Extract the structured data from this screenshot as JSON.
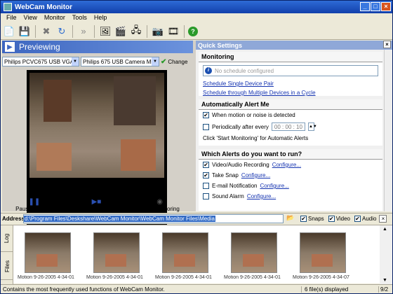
{
  "app": {
    "title": "WebCam Monitor"
  },
  "menu": [
    "File",
    "View",
    "Monitor",
    "Tools",
    "Help"
  ],
  "toolbar": {
    "tools": [
      {
        "name": "new-icon",
        "glyph": "📄"
      },
      {
        "name": "save-icon",
        "glyph": "💾"
      },
      {
        "name": "delete-icon",
        "glyph": "✖"
      },
      {
        "name": "refresh-icon",
        "glyph": "↻"
      },
      {
        "name": "forward-icon",
        "glyph": "»"
      },
      {
        "name": "snapshot-icon",
        "glyph": "🖼"
      },
      {
        "name": "record-icon",
        "glyph": "🎬"
      },
      {
        "name": "devices-icon",
        "glyph": "🖧"
      },
      {
        "name": "camera-icon",
        "glyph": "📷"
      },
      {
        "name": "film-icon",
        "glyph": "🎞"
      },
      {
        "name": "help-icon",
        "glyph": "?"
      }
    ]
  },
  "preview": {
    "header": "Previewing",
    "video_device": "Philips PCVC675 USB VGA C",
    "audio_device": "Philips 675 USB Camera Mic",
    "change_label": "Change",
    "pause_label": "Pause Preview",
    "stop_label": "Stop Preview",
    "start_label": "Start Monitoring"
  },
  "quick_settings": {
    "title": "Quick Settings",
    "monitoring": {
      "title": "Monitoring",
      "schedule_placeholder": "No schedule configured",
      "link1": "Schedule Single Device Pair",
      "link2": "Schedule through Multiple Devices in a Cycle"
    },
    "alert": {
      "title": "Automatically Alert Me",
      "opt1": "When motion or noise is detected",
      "opt2": "Periodically after every",
      "time": "00 : 00 : 10",
      "note": "Click 'Start Monitoring' for Automatic Alerts"
    },
    "alerts_run": {
      "title": "Which Alerts do you want to run?",
      "items": [
        {
          "label": "Video/Audio Recording",
          "link": "Configure...",
          "checked": true
        },
        {
          "label": "Take Snap",
          "link": "Configure...",
          "checked": true
        },
        {
          "label": "E-mail Notification",
          "link": "Configure...",
          "checked": false
        },
        {
          "label": "Sound Alarm",
          "link": "Configure...",
          "checked": false
        }
      ]
    }
  },
  "address": {
    "label": "Address",
    "path": "d:\\Program Files\\Deskshare\\WebCam Monitor\\WebCam Monitor Files\\Media",
    "snaps": "Snaps",
    "video": "Video",
    "audio": "Audio"
  },
  "tabs": {
    "log": "Log",
    "files": "Files"
  },
  "thumbnails": [
    {
      "caption": "Motion 9-26-2005 4-34-01"
    },
    {
      "caption": "Motion 9-26-2005 4-34-01"
    },
    {
      "caption": "Motion 9-26-2005 4-34-01"
    },
    {
      "caption": "Motion 9-26-2005 4-34-01"
    },
    {
      "caption": "Motion 9-26-2005 4-34-07"
    }
  ],
  "status": {
    "message": "Contains the most frequently used functions of WebCam Monitor.",
    "count": "6 file(s) displayed",
    "page": "9/2"
  }
}
